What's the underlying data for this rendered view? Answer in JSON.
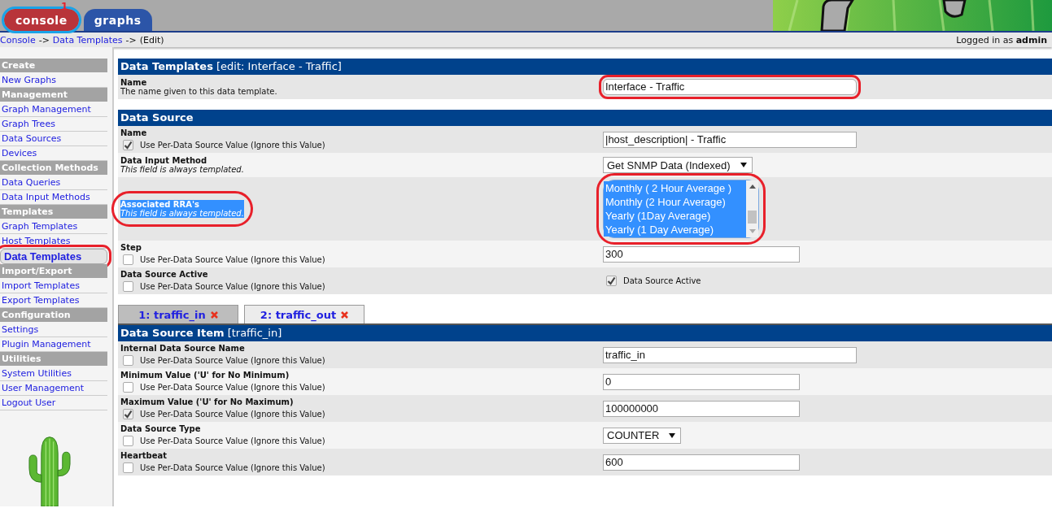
{
  "header": {
    "tabs": [
      {
        "label": "console",
        "selected": true,
        "annotated": true
      },
      {
        "label": "graphs",
        "selected": false
      }
    ],
    "annotation_number": "1"
  },
  "breadcrumb": [
    {
      "label": "Console",
      "kind": "link"
    },
    {
      "label": "->",
      "kind": "separator"
    },
    {
      "label": "Data Templates",
      "kind": "link"
    },
    {
      "label": "->",
      "kind": "separator"
    },
    {
      "label": "(Edit)",
      "kind": "text"
    }
  ],
  "user": {
    "prefix": "Logged in as",
    "name": "admin"
  },
  "sidebar": {
    "sections": [
      {
        "title": "Create",
        "items": [
          {
            "label": "New Graphs",
            "selected": false
          }
        ]
      },
      {
        "title": "Management",
        "items": [
          {
            "label": "Graph Management",
            "selected": false
          },
          {
            "label": "Graph Trees",
            "selected": false
          },
          {
            "label": "Data Sources",
            "selected": false
          },
          {
            "label": "Devices",
            "selected": false
          }
        ]
      },
      {
        "title": "Collection Methods",
        "items": [
          {
            "label": "Data Queries",
            "selected": false
          },
          {
            "label": "Data Input Methods",
            "selected": false
          }
        ]
      },
      {
        "title": "Templates",
        "items": [
          {
            "label": "Graph Templates",
            "selected": false
          },
          {
            "label": "Host Templates",
            "selected": false
          },
          {
            "label": "Data Templates",
            "selected": true,
            "annotated": true
          }
        ]
      },
      {
        "title": "Import/Export",
        "items": [
          {
            "label": "Import Templates",
            "selected": false
          },
          {
            "label": "Export Templates",
            "selected": false
          }
        ]
      },
      {
        "title": "Configuration",
        "items": [
          {
            "label": "Settings",
            "selected": false
          },
          {
            "label": "Plugin Management",
            "selected": false
          }
        ]
      },
      {
        "title": "Utilities",
        "items": [
          {
            "label": "System Utilities",
            "selected": false
          },
          {
            "label": "User Management",
            "selected": false
          },
          {
            "label": "Logout User",
            "selected": false
          }
        ]
      }
    ]
  },
  "template_panel": {
    "title": "Data Templates",
    "subtitle": "[edit: Interface - Traffic]",
    "rows": [
      {
        "label": "Name",
        "description": "The name given to this data template.",
        "kind": "text",
        "value": "Interface - Traffic",
        "annotated": true
      }
    ]
  },
  "data_source_panel": {
    "title": "Data Source",
    "rows": [
      {
        "label": "Name",
        "override": {
          "label": "Use Per-Data Source Value (Ignore this Value)",
          "checked": true
        },
        "kind": "text",
        "value": "|host_description| - Traffic"
      },
      {
        "label": "Data Input Method",
        "note": "This field is always templated.",
        "kind": "select",
        "value": "Get SNMP Data (Indexed)"
      },
      {
        "label": "Associated RRA's",
        "note": "This field is always templated.",
        "text_selected": true,
        "kind": "listbox",
        "annotated": true,
        "options": [
          {
            "label": "Monthly ( 2 Hour Average )",
            "selected": true
          },
          {
            "label": "Monthly (2 Hour Average)",
            "selected": true
          },
          {
            "label": "Yearly (1Day Average)",
            "selected": true
          },
          {
            "label": "Yearly (1 Day Average)",
            "selected": true
          }
        ]
      },
      {
        "label": "Step",
        "override": {
          "label": "Use Per-Data Source Value (Ignore this Value)",
          "checked": false
        },
        "kind": "number",
        "value": "300"
      },
      {
        "label": "Data Source Active",
        "override": {
          "label": "Use Per-Data Source Value (Ignore this Value)",
          "checked": false
        },
        "kind": "checkbox",
        "checkbox": {
          "label": "Data Source Active",
          "checked": true
        }
      }
    ]
  },
  "item_tabs": [
    {
      "label": "1: traffic_in",
      "selected": true
    },
    {
      "label": "2: traffic_out",
      "selected": false
    }
  ],
  "item_panel": {
    "title": "Data Source Item",
    "subtitle": "[traffic_in]",
    "rows": [
      {
        "label": "Internal Data Source Name",
        "override": {
          "label": "Use Per-Data Source Value (Ignore this Value)",
          "checked": false
        },
        "kind": "text",
        "value": "traffic_in"
      },
      {
        "label": "Minimum Value ('U' for No Minimum)",
        "override": {
          "label": "Use Per-Data Source Value (Ignore this Value)",
          "checked": false
        },
        "kind": "number",
        "value": "0"
      },
      {
        "label": "Maximum Value ('U' for No Maximum)",
        "override": {
          "label": "Use Per-Data Source Value (Ignore this Value)",
          "checked": true
        },
        "kind": "number",
        "value": "100000000"
      },
      {
        "label": "Data Source Type",
        "override": {
          "label": "Use Per-Data Source Value (Ignore this Value)",
          "checked": false
        },
        "kind": "select",
        "value": "COUNTER"
      },
      {
        "label": "Heartbeat",
        "override": {
          "label": "Use Per-Data Source Value (Ignore this Value)",
          "checked": false
        },
        "kind": "number",
        "value": "600"
      }
    ]
  }
}
